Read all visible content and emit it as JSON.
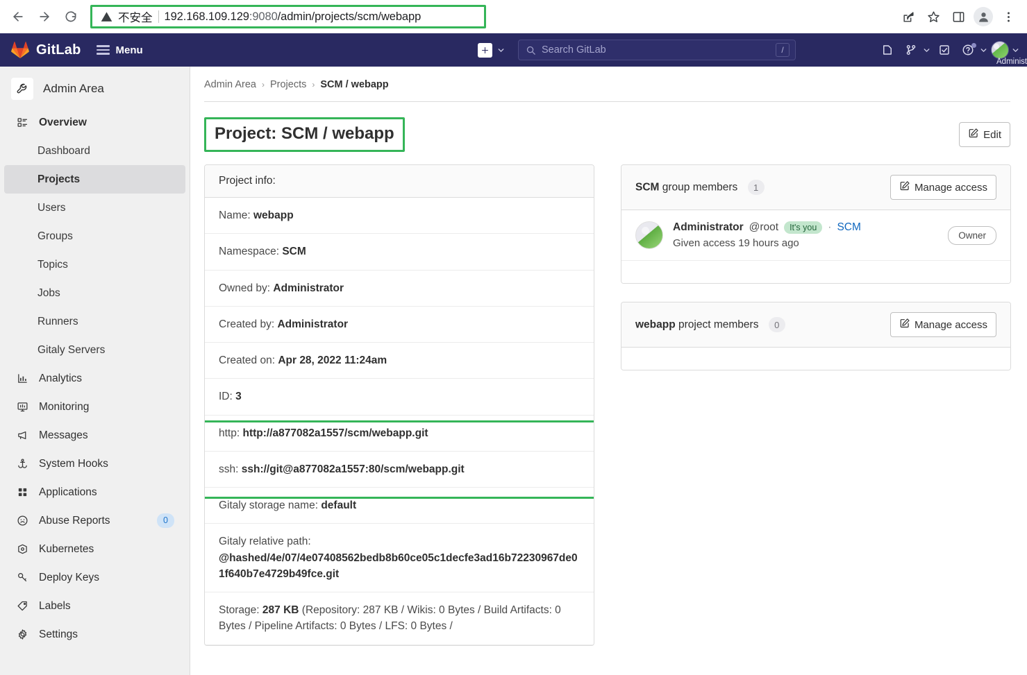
{
  "browser": {
    "back_label": "Back",
    "forward_label": "Forward",
    "reload_label": "Reload",
    "security_label": "不安全",
    "url_host": "192.168.109.129",
    "url_port": ":9080",
    "url_path": "/admin/projects/scm/webapp",
    "url_full": "192.168.109.129:9080/admin/projects/scm/webapp",
    "share_label": "Share",
    "bookmark_label": "Bookmark this tab",
    "sidepanel_label": "Side panel",
    "profile_label": "Profile",
    "menu_label": "Customize and control"
  },
  "navbar": {
    "brand": "GitLab",
    "menu_label": "Menu",
    "search_placeholder": "Search GitLab",
    "search_value": "",
    "search_shortcut": "/",
    "create_new_label": "Create new...",
    "issues_label": "Issues",
    "merge_requests_label": "Merge requests",
    "todos_label": "To-Do List",
    "help_label": "Help",
    "user_name": "Administrator"
  },
  "sidebar": {
    "area_title": "Admin Area",
    "overview_label": "Overview",
    "overview_children": [
      {
        "label": "Dashboard",
        "active": false
      },
      {
        "label": "Projects",
        "active": true
      },
      {
        "label": "Users",
        "active": false
      },
      {
        "label": "Groups",
        "active": false
      },
      {
        "label": "Topics",
        "active": false
      },
      {
        "label": "Jobs",
        "active": false
      },
      {
        "label": "Runners",
        "active": false
      },
      {
        "label": "Gitaly Servers",
        "active": false
      }
    ],
    "items": [
      {
        "label": "Analytics",
        "icon": "chart-icon",
        "badge": ""
      },
      {
        "label": "Monitoring",
        "icon": "monitor-icon",
        "badge": ""
      },
      {
        "label": "Messages",
        "icon": "megaphone-icon",
        "badge": ""
      },
      {
        "label": "System Hooks",
        "icon": "hook-icon",
        "badge": ""
      },
      {
        "label": "Applications",
        "icon": "grid-icon",
        "badge": ""
      },
      {
        "label": "Abuse Reports",
        "icon": "frown-icon",
        "badge": "0"
      },
      {
        "label": "Kubernetes",
        "icon": "kubernetes-icon",
        "badge": ""
      },
      {
        "label": "Deploy Keys",
        "icon": "key-icon",
        "badge": ""
      },
      {
        "label": "Labels",
        "icon": "label-icon",
        "badge": ""
      },
      {
        "label": "Settings",
        "icon": "gear-icon",
        "badge": ""
      }
    ]
  },
  "breadcrumb": {
    "item1": "Admin Area",
    "item2": "Projects",
    "current": "SCM / webapp",
    "sep": "›"
  },
  "page": {
    "title": "Project: SCM / webapp",
    "edit_label": "Edit"
  },
  "project_info": {
    "header": "Project info:",
    "rows": [
      {
        "label": "Name:",
        "value": "webapp"
      },
      {
        "label": "Namespace:",
        "value": "SCM"
      },
      {
        "label": "Owned by:",
        "value": "Administrator"
      },
      {
        "label": "Created by:",
        "value": "Administrator"
      },
      {
        "label": "Created on:",
        "value": "Apr 28, 2022 11:24am"
      },
      {
        "label": "ID:",
        "value": "3"
      },
      {
        "label": "http:",
        "value": "http://a877082a1557/scm/webapp.git"
      },
      {
        "label": "ssh:",
        "value": "ssh://git@a877082a1557:80/scm/webapp.git"
      },
      {
        "label": "Gitaly storage name:",
        "value": "default"
      }
    ],
    "gitaly_path_label": "Gitaly relative path:",
    "gitaly_path_value": "@hashed/4e/07/4e07408562bedb8b60ce05c1decfe3ad16b72230967de01f640b7e4729b49fce.git",
    "storage_label": "Storage:",
    "storage_value": "287 KB",
    "storage_detail": "(Repository: 287 KB / Wikis: 0 Bytes / Build Artifacts: 0 Bytes / Pipeline Artifacts: 0 Bytes / LFS: 0 Bytes /"
  },
  "group_members": {
    "name": "SCM",
    "suffix": "group members",
    "count": "1",
    "manage_label": "Manage access",
    "member": {
      "name": "Administrator",
      "handle": "@root",
      "you_badge": "It's you",
      "dot": "·",
      "group": "SCM",
      "access_text": "Given access 19 hours ago",
      "role": "Owner"
    }
  },
  "project_members": {
    "name": "webapp",
    "suffix": "project members",
    "count": "0",
    "manage_label": "Manage access"
  },
  "colors": {
    "navbar": "#292961",
    "annotation_green": "#35b558",
    "accent_blue": "#1068bf",
    "badge_green_bg": "#c3e6cd"
  }
}
